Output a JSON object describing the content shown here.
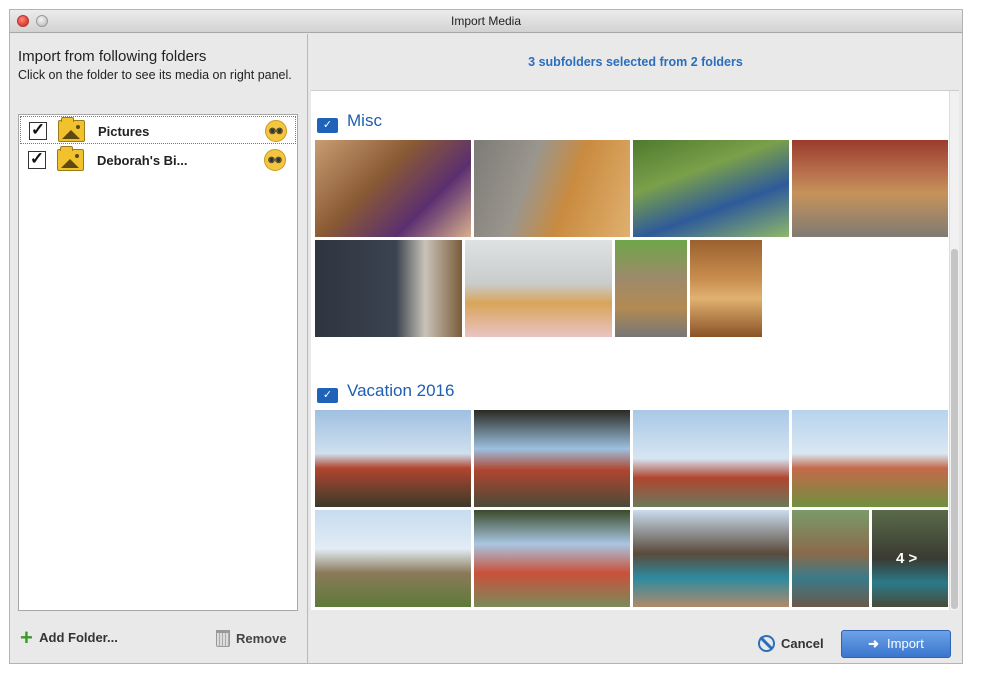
{
  "window": {
    "title": "Import Media"
  },
  "left": {
    "heading": "Import from following folders",
    "instructions": "Click on the folder to see its media on right panel.",
    "folders": [
      {
        "label": "Pictures",
        "checked": true,
        "selected": true
      },
      {
        "label": "Deborah's Bi...",
        "checked": true,
        "selected": false
      }
    ],
    "add_folder_label": "Add Folder...",
    "remove_label": "Remove"
  },
  "right": {
    "summary": "3 subfolders selected from 2 folders",
    "sections": [
      {
        "title": "Misc",
        "photo_count": 8
      },
      {
        "title": "Vacation 2016",
        "photo_count": 8,
        "more_label": "4 >"
      }
    ],
    "cancel_label": "Cancel",
    "import_label": "Import"
  },
  "colors": {
    "accent": "#2a6ebd",
    "folder_yellow": "#f2c12e",
    "import_button": "#4a84d6"
  },
  "icons": {
    "check": "✓",
    "plus": "+",
    "binoculars": "◉◉",
    "arrow": "➜"
  }
}
